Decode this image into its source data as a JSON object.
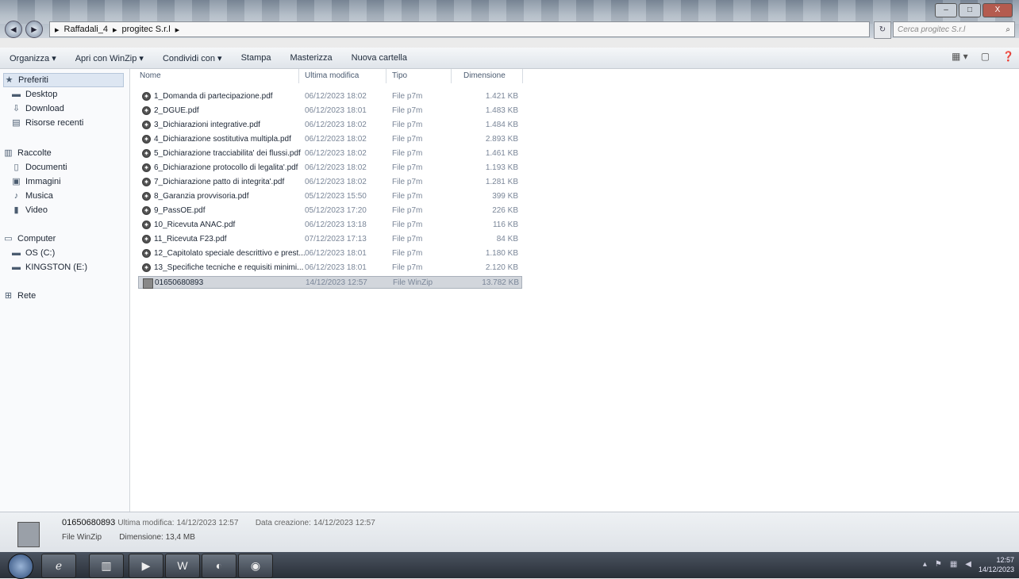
{
  "window": {
    "breadcrumb": [
      "Raffadali_4",
      "progitec S.r.l"
    ],
    "search_placeholder": "Cerca progitec S.r.l",
    "controls": [
      "–",
      "□",
      "X"
    ]
  },
  "toolbar": {
    "items": [
      "Organizza ▾",
      "Apri con WinZip ▾",
      "Condividi con ▾",
      "Stampa",
      "Masterizza",
      "Nuova cartella"
    ]
  },
  "sidebar": {
    "preferiti": {
      "label": "Preferiti",
      "items": [
        "Desktop",
        "Download",
        "Risorse recenti"
      ]
    },
    "raccolte": {
      "label": "Raccolte",
      "items": [
        "Documenti",
        "Immagini",
        "Musica",
        "Video"
      ]
    },
    "computer": {
      "label": "Computer",
      "items": [
        "OS (C:)",
        "KINGSTON (E:)"
      ]
    },
    "rete": {
      "label": "Rete"
    }
  },
  "columns": {
    "name": "Nome",
    "modified": "Ultima modifica",
    "type": "Tipo",
    "size": "Dimensione"
  },
  "files": [
    {
      "name": "1_Domanda di partecipazione.pdf",
      "modified": "06/12/2023 18:02",
      "type": "File p7m",
      "size": "1.421 KB"
    },
    {
      "name": "2_DGUE.pdf",
      "modified": "06/12/2023 18:01",
      "type": "File p7m",
      "size": "1.483 KB"
    },
    {
      "name": "3_Dichiarazioni integrative.pdf",
      "modified": "06/12/2023 18:02",
      "type": "File p7m",
      "size": "1.484 KB"
    },
    {
      "name": "4_Dichiarazione sostitutiva multipla.pdf",
      "modified": "06/12/2023 18:02",
      "type": "File p7m",
      "size": "2.893 KB"
    },
    {
      "name": "5_Dichiarazione tracciabilita' dei flussi.pdf",
      "modified": "06/12/2023 18:02",
      "type": "File p7m",
      "size": "1.461 KB"
    },
    {
      "name": "6_Dichiarazione protocollo di legalita'.pdf",
      "modified": "06/12/2023 18:02",
      "type": "File p7m",
      "size": "1.193 KB"
    },
    {
      "name": "7_Dichiarazione patto di integrita'.pdf",
      "modified": "06/12/2023 18:02",
      "type": "File p7m",
      "size": "1.281 KB"
    },
    {
      "name": "8_Garanzia provvisoria.pdf",
      "modified": "05/12/2023 15:50",
      "type": "File p7m",
      "size": "399 KB"
    },
    {
      "name": "9_PassOE.pdf",
      "modified": "05/12/2023 17:20",
      "type": "File p7m",
      "size": "226 KB"
    },
    {
      "name": "10_Ricevuta ANAC.pdf",
      "modified": "06/12/2023 13:18",
      "type": "File p7m",
      "size": "116 KB"
    },
    {
      "name": "11_Ricevuta F23.pdf",
      "modified": "07/12/2023 17:13",
      "type": "File p7m",
      "size": "84 KB"
    },
    {
      "name": "12_Capitolato speciale descrittivo e prest...",
      "modified": "06/12/2023 18:01",
      "type": "File p7m",
      "size": "1.180 KB"
    },
    {
      "name": "13_Specifiche tecniche e requisiti minimi...",
      "modified": "06/12/2023 18:01",
      "type": "File p7m",
      "size": "2.120 KB"
    },
    {
      "name": "01650680893",
      "modified": "14/12/2023 12:57",
      "type": "File WinZip",
      "size": "13.782 KB"
    }
  ],
  "details": {
    "name": "01650680893",
    "modified_label": "Ultima modifica:",
    "modified_value": "14/12/2023 12:57",
    "created_label": "Data creazione:",
    "created_value": "14/12/2023 12:57",
    "type": "File WinZip",
    "size_label": "Dimensione:",
    "size_value": "13,4 MB"
  },
  "taskbar": {
    "time": "12:57",
    "date": "14/12/2023",
    "word_label": "W"
  }
}
